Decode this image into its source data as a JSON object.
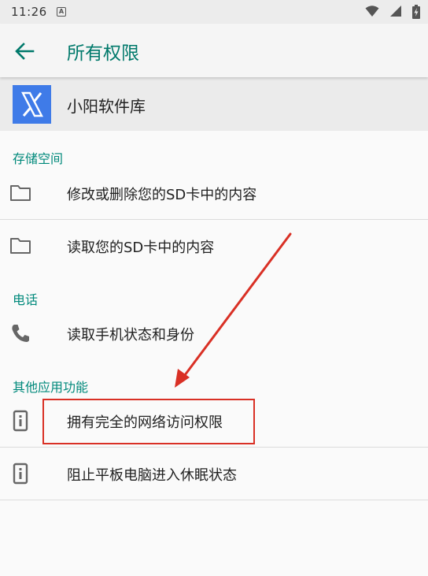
{
  "status_bar": {
    "time": "11:26",
    "notification_badge": "A",
    "icons": [
      "wifi-icon",
      "signal-icon",
      "battery-charging-icon"
    ]
  },
  "app_bar": {
    "title": "所有权限",
    "back_icon": "arrow-left-icon",
    "accent_color": "#00796b"
  },
  "app": {
    "name": "小阳软件库",
    "icon_color": "#3f7be8"
  },
  "sections": [
    {
      "label": "存储空间",
      "items": [
        {
          "label": "修改或删除您的SD卡中的内容",
          "icon": "folder-icon"
        },
        {
          "label": "读取您的SD卡中的内容",
          "icon": "folder-icon"
        }
      ]
    },
    {
      "label": "电话",
      "items": [
        {
          "label": "读取手机状态和身份",
          "icon": "phone-icon"
        }
      ]
    },
    {
      "label": "其他应用功能",
      "items": [
        {
          "label": "拥有完全的网络访问权限",
          "icon": "device-info-icon"
        },
        {
          "label": "阻止平板电脑进入休眠状态",
          "icon": "device-info-icon"
        }
      ]
    }
  ],
  "annotation": {
    "color": "#d93025",
    "highlighted_item": "拥有完全的网络访问权限"
  }
}
